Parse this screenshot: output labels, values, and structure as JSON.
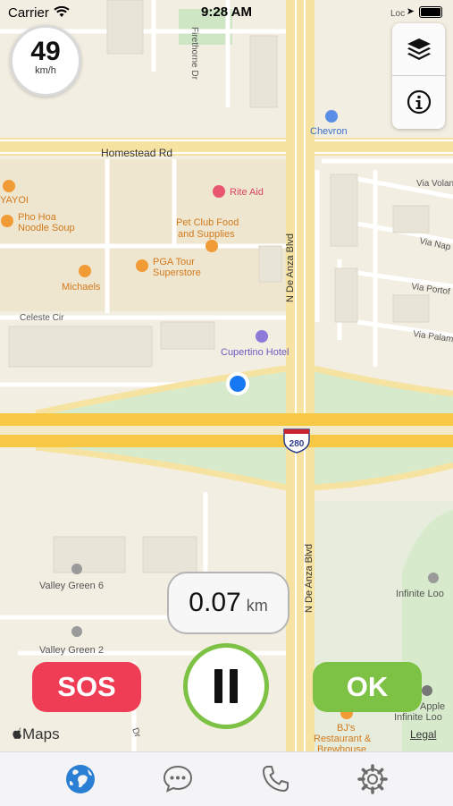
{
  "status_bar": {
    "carrier": "Carrier",
    "time": "9:28 AM"
  },
  "speed": {
    "value": "49",
    "unit": "km/h"
  },
  "distance": {
    "value": "0.07",
    "unit": "km"
  },
  "actions": {
    "sos_label": "SOS",
    "ok_label": "OK"
  },
  "map": {
    "attribution": "Maps",
    "legal": "Legal",
    "streets": {
      "homestead": "Homestead Rd",
      "de_anza_upper": "N De Anza Blvd",
      "de_anza_lower": "N De Anza Blvd",
      "firethorne": "Firethorne Dr",
      "celeste": "Celeste Cir",
      "via_volante": "Via Volan",
      "via_napoli": "Via Nap",
      "via_portofino": "Via Portof",
      "via_palermo": "Via Palam",
      "loc": "Loc",
      "dr": "Dr"
    },
    "highway_shield": "280",
    "pois": {
      "chevron": "Chevron",
      "rite_aid": "Rite Aid",
      "yayoi": "YAYOI",
      "pho_hoa_1": "Pho Hoa",
      "pho_hoa_2": "Noodle Soup",
      "pet_club_1": "Pet Club Food",
      "pet_club_2": "and Supplies",
      "pga_1": "PGA Tour",
      "pga_2": "Superstore",
      "michaels": "Michaels",
      "cupertino_hotel": "Cupertino Hotel",
      "valley_green_6": "Valley Green 6",
      "valley_green_2": "Valley Green 2",
      "infinite_loop": "Infinite Loo",
      "apple_1": "Apple",
      "apple_2": "Infinite Loo",
      "bjs_1": "BJ's",
      "bjs_2": "Restaurant &",
      "bjs_3": "Brewhouse"
    }
  },
  "colors": {
    "sos": "#ee3d55",
    "ok": "#7dc244",
    "highway": "#f7c843",
    "road_major": "#f6e3a1",
    "green_area": "#d7ebcc",
    "poi_orange": "#f19b37",
    "poi_pink": "#e9566f",
    "poi_blue": "#5b8ee6",
    "location_dot": "#1877f2"
  },
  "tabs": [
    {
      "name": "globe-icon",
      "active": true
    },
    {
      "name": "chat-icon",
      "active": false
    },
    {
      "name": "phone-icon",
      "active": false
    },
    {
      "name": "settings-icon",
      "active": false
    }
  ]
}
